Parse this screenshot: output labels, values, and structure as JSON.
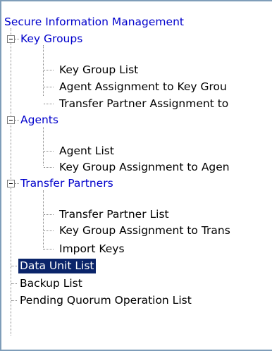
{
  "tree": {
    "root": {
      "label": "Secure Information Management"
    },
    "groups": [
      {
        "label": "Key Groups",
        "expanded": true,
        "children": [
          {
            "label": "Key Group List"
          },
          {
            "label": "Agent Assignment to Key Grou"
          },
          {
            "label": "Transfer Partner Assignment to"
          }
        ]
      },
      {
        "label": "Agents",
        "expanded": true,
        "children": [
          {
            "label": "Agent List"
          },
          {
            "label": "Key Group Assignment to Agen"
          }
        ]
      },
      {
        "label": "Transfer Partners",
        "expanded": true,
        "children": [
          {
            "label": "Transfer Partner List"
          },
          {
            "label": "Key Group Assignment to Trans"
          },
          {
            "label": "Import Keys"
          }
        ]
      }
    ],
    "leaves": [
      {
        "label": "Data Unit List",
        "selected": true
      },
      {
        "label": "Backup List"
      },
      {
        "label": "Pending Quorum Operation List"
      }
    ]
  },
  "colors": {
    "link": "#0000cc",
    "selected_bg": "#0a246a",
    "selected_fg": "#ffffff",
    "border": "#7f9db9"
  }
}
